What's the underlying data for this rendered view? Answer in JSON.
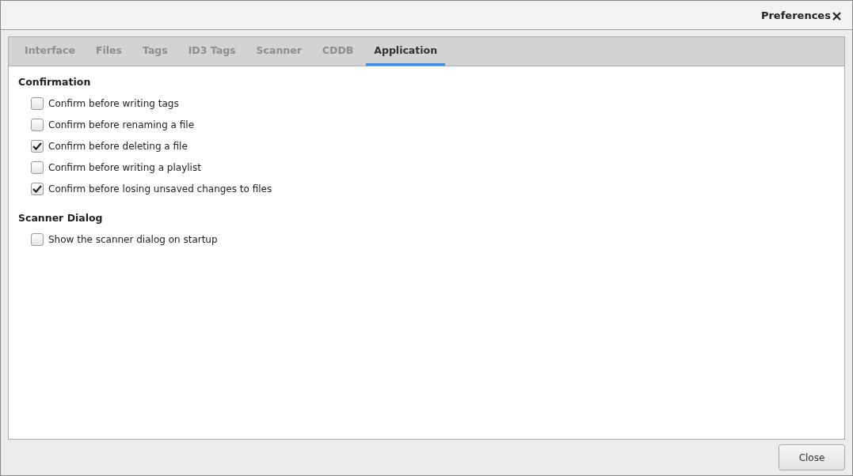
{
  "window": {
    "title": "Preferences",
    "close": "×"
  },
  "tabs": [
    {
      "label": "Interface",
      "selected": false
    },
    {
      "label": "Files",
      "selected": false
    },
    {
      "label": "Tags",
      "selected": false
    },
    {
      "label": "ID3 Tags",
      "selected": false
    },
    {
      "label": "Scanner",
      "selected": false
    },
    {
      "label": "CDDB",
      "selected": false
    },
    {
      "label": "Application",
      "selected": true
    }
  ],
  "sections": [
    {
      "title": "Confirmation",
      "options": [
        {
          "label": "Confirm before writing tags",
          "checked": false
        },
        {
          "label": "Confirm before renaming a file",
          "checked": false
        },
        {
          "label": "Confirm before deleting a file",
          "checked": true
        },
        {
          "label": "Confirm before writing a playlist",
          "checked": false
        },
        {
          "label": "Confirm before losing unsaved changes to files",
          "checked": true
        }
      ]
    },
    {
      "title": "Scanner Dialog",
      "options": [
        {
          "label": "Show the scanner dialog on startup",
          "checked": false
        }
      ]
    }
  ],
  "buttons": [
    "Close"
  ]
}
